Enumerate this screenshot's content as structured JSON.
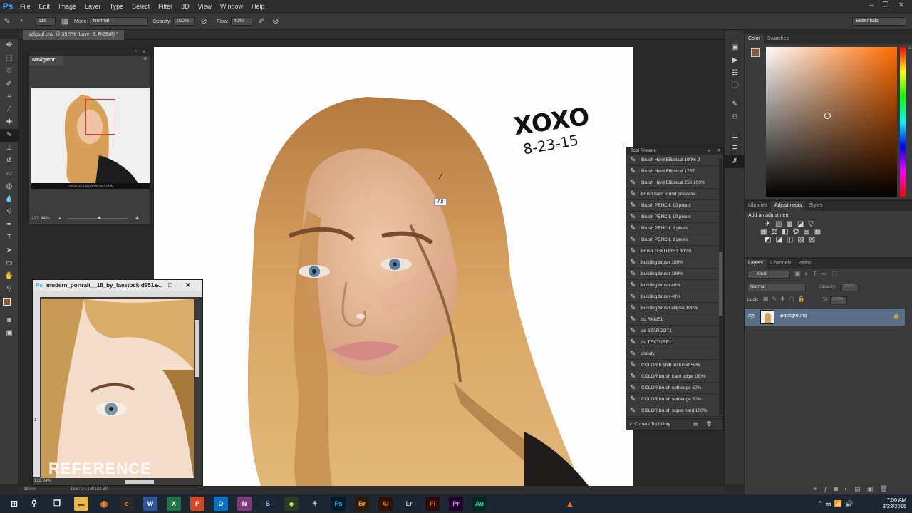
{
  "app": {
    "logo": "Ps"
  },
  "menu": [
    "File",
    "Edit",
    "Image",
    "Layer",
    "Type",
    "Select",
    "Filter",
    "3D",
    "View",
    "Window",
    "Help"
  ],
  "options": {
    "brush_size": "115",
    "mode_label": "Mode:",
    "mode_value": "Normal",
    "opacity_label": "Opacity:",
    "opacity_value": "100%",
    "flow_label": "Flow:",
    "flow_value": "40%",
    "workspace": "Essentials"
  },
  "document": {
    "tab": "szfgsgf.psd @ 39.5% (Layer 3, RGB/8) *"
  },
  "navigator": {
    "title": "Navigator",
    "zoom": "122.94%",
    "thumb_caption": "FAESTOCK.DEVIANTART.COM"
  },
  "reference": {
    "title": "modern_portrait__18_by_faestock-d951z...",
    "watermark": "REFERENCE",
    "zoom": "122.94%",
    "doc": "Doc: 24.1M/132.5M",
    "ruler_mark": "1"
  },
  "canvas": {
    "signature": "XOXO",
    "date": "8-23-15",
    "tooltip": "Alt"
  },
  "tool_presets": {
    "title": "Tool Presets",
    "items": [
      "Brush Hard Elliptical 100% 2",
      "Brush Hard Elliptical 175T",
      "Brush Hard Elliptical 250 100%",
      "brush hard round pressure",
      "Brush PENCIL 10 pixels",
      "Brush PENCIL 10 pixels",
      "Brush PENCIL 2 pixels",
      "Brush PENCIL 2 pixels",
      "brush TEXTURE1 30/30",
      "building brush 100%",
      "building brush 100%",
      "building brush 40%",
      "building brush 40%",
      "building brush ellipse 100%",
      "cd RAKE1",
      "cd STARDOT1",
      "cd TEXTURE1",
      "cloudy",
      "COLOR b shift textured 50%",
      "COLOR brush hard edge 100%",
      "COLOR brush soft edge 50%",
      "COLOR brush soft edge 50%",
      "COLOR brush super hard 100%"
    ],
    "footer": "Current Tool Only"
  },
  "color_panel": {
    "tabs": [
      "Color",
      "Swatches"
    ],
    "fg": "#8a5a3c"
  },
  "adjust_panel": {
    "tabs": [
      "Libraries",
      "Adjustments",
      "Styles"
    ],
    "heading": "Add an adjustment"
  },
  "layers_panel": {
    "tabs": [
      "Layers",
      "Channels",
      "Paths"
    ],
    "filter": "Kind",
    "blend": "Normal",
    "opacity_label": "Opacity:",
    "opacity_value": "100%",
    "lock_label": "Lock:",
    "fill_label": "Fill:",
    "fill_value": "100%",
    "layer_name": "Background"
  },
  "statusbar": {
    "zoom": "39.5%"
  },
  "taskbar": {
    "time": "7:56 AM",
    "date": "8/23/2015",
    "apps": [
      {
        "label": "e",
        "color": "#2a2a2a",
        "fg": "#f58220"
      },
      {
        "label": "W",
        "color": "#2b579a",
        "fg": "#fff"
      },
      {
        "label": "X",
        "color": "#217346",
        "fg": "#fff"
      },
      {
        "label": "P",
        "color": "#d24726",
        "fg": "#fff"
      },
      {
        "label": "O",
        "color": "#0072c6",
        "fg": "#fff"
      },
      {
        "label": "N",
        "color": "#80397b",
        "fg": "#fff"
      },
      {
        "label": "S",
        "color": "#1b2838",
        "fg": "#9ec6e6"
      },
      {
        "label": "◆",
        "color": "#2d3a22",
        "fg": "#c7d46a"
      },
      {
        "label": "⚘",
        "color": "#1c2733",
        "fg": "#ddd"
      },
      {
        "label": "Ps",
        "color": "#001d26",
        "fg": "#31a8ff"
      },
      {
        "label": "Br",
        "color": "#2b1a06",
        "fg": "#e8a03c"
      },
      {
        "label": "Ai",
        "color": "#2b1400",
        "fg": "#ff7c00"
      },
      {
        "label": "Lr",
        "color": "#1b2630",
        "fg": "#b5c8d8"
      },
      {
        "label": "Fl",
        "color": "#2a0d0d",
        "fg": "#ff4a3b"
      },
      {
        "label": "Pr",
        "color": "#20032b",
        "fg": "#e77cf4"
      },
      {
        "label": "Au",
        "color": "#00291b",
        "fg": "#00e4bb"
      }
    ]
  }
}
